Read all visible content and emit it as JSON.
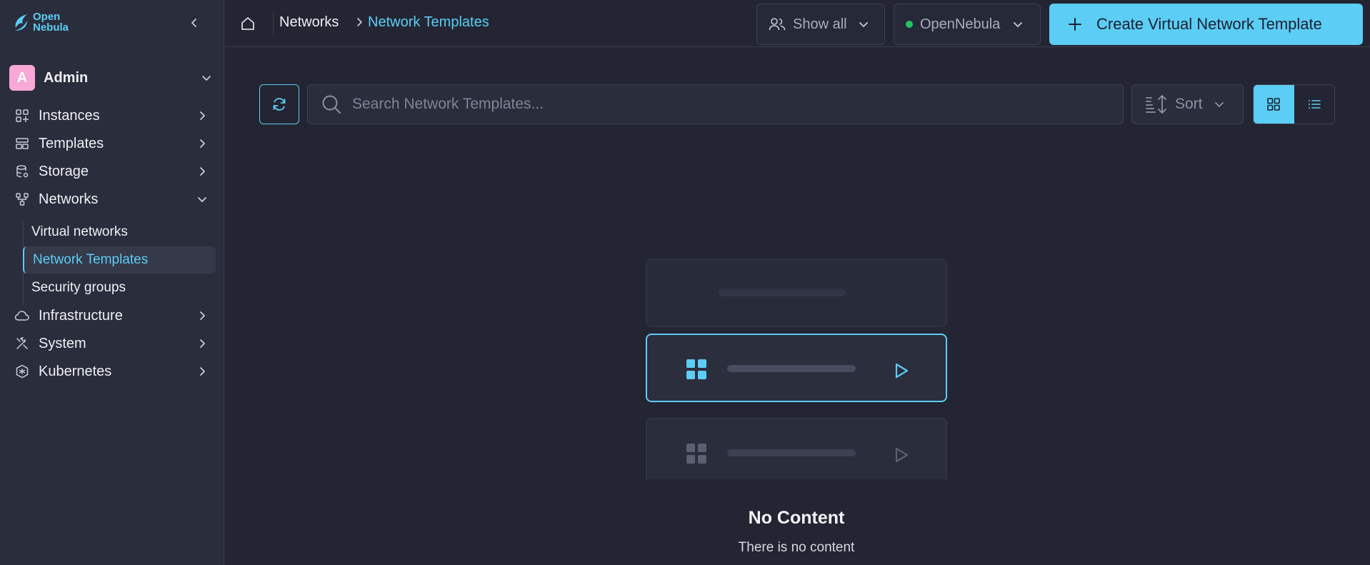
{
  "brand": {
    "name_line1": "Open",
    "name_line2": "Nebula"
  },
  "user": {
    "initial": "A",
    "name": "Admin"
  },
  "nav": {
    "instances": "Instances",
    "templates": "Templates",
    "storage": "Storage",
    "networks": "Networks",
    "infrastructure": "Infrastructure",
    "system": "System",
    "kubernetes": "Kubernetes"
  },
  "networks_sub": {
    "virtual_networks": "Virtual networks",
    "network_templates": "Network Templates",
    "security_groups": "Security groups"
  },
  "breadcrumb": {
    "parent": "Networks",
    "current": "Network Templates"
  },
  "topbar": {
    "show_all": "Show all",
    "cloud": "OpenNebula",
    "cloud_status_color": "#22c55e",
    "create_label": "Create Virtual Network Template"
  },
  "toolbar": {
    "search_placeholder": "Search Network Templates...",
    "sort_label": "Sort",
    "view_mode": "grid"
  },
  "empty_state": {
    "title": "No Content",
    "subtitle": "There is no content"
  },
  "colors": {
    "accent": "#5ccdf5",
    "background": "#232533",
    "sidebar": "#2a2d3b"
  }
}
